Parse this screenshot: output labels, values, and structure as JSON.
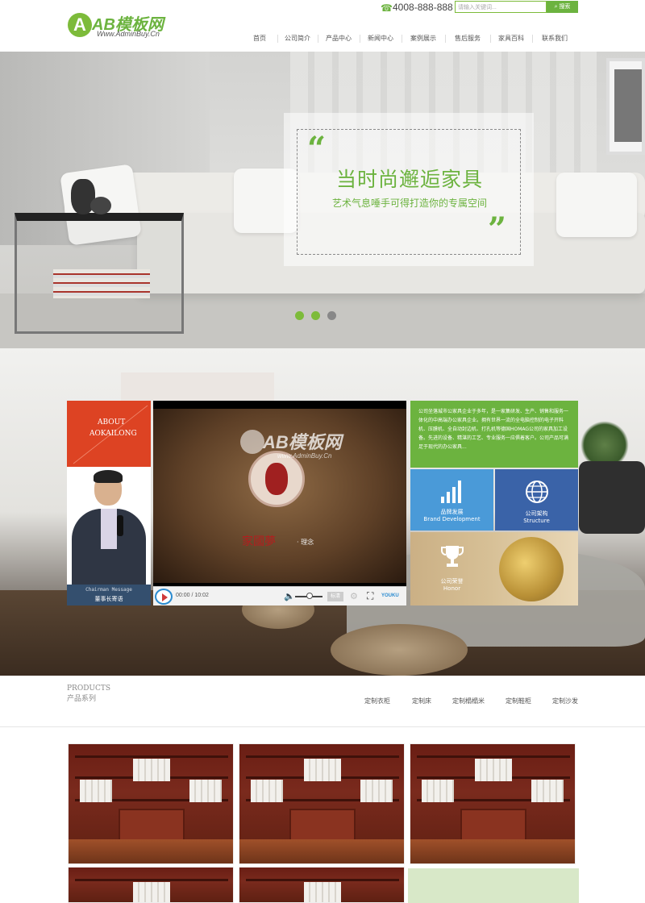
{
  "header": {
    "logo_text": "AB模板网",
    "logo_letter": "A",
    "logo_url": "Www.AdminBuy.Cn",
    "phone": "4008-888-888",
    "search_placeholder": "请输入关键词...",
    "search_button": "搜索",
    "nav": [
      "首页",
      "公司简介",
      "产品中心",
      "新闻中心",
      "案例展示",
      "售后服务",
      "家具百科",
      "联系我们"
    ]
  },
  "banner": {
    "title": "当时尚邂逅家具",
    "subtitle": "艺术气息唾手可得打造你的专属空间",
    "open_quote": "“",
    "close_quote": "”",
    "dots": 3,
    "active_dot": 0
  },
  "about": {
    "label_en_1": "ABOUT",
    "label_en_2": "AOKAILONG",
    "chairman_en": "Chairman Message",
    "chairman_cn": "董事长寄语",
    "intro": "公司坐落城市公家具企业于多年，是一家集研发、生产、销售和服务一体化的中高端办公家具企业。拥有世界一流的全电脑控制的电子开料机、压膜机、全自动封边机、打孔机等德国HOMAG公司的家具加工设备。先进的设备、精湛的工艺、专业服务一应俱着客户。公司产品可满足于现代的办公家具...",
    "video": {
      "watermark": "AB模板网",
      "watermark_url": "www.AdminBuy.Cn",
      "caption": "家國夢",
      "caption_small": "· 理念",
      "time": "00:00 / 10:02",
      "quality": "标清",
      "brand": "YOUKU"
    },
    "tiles": [
      {
        "cn": "品牌发展",
        "en": "Brand Development",
        "icon": "bar-chart-icon",
        "color": "#4a9ad8"
      },
      {
        "cn": "公司架构",
        "en": "Structure",
        "icon": "globe-icon",
        "color": "#3a63a8"
      },
      {
        "cn": "公司荣誉",
        "en": "Honor",
        "icon": "trophy-icon",
        "color": "#c9aa7a"
      }
    ]
  },
  "products": {
    "title_en": "PRODUCTS",
    "title_cn": "产品系列",
    "tabs": [
      "定制衣柜",
      "定制床",
      "定制榻榻米",
      "定制鞋柜",
      "定制沙发"
    ]
  },
  "colors": {
    "brand_green": "#6cb33f",
    "about_red": "#dd4323",
    "chairman_blue": "#344f6e"
  }
}
